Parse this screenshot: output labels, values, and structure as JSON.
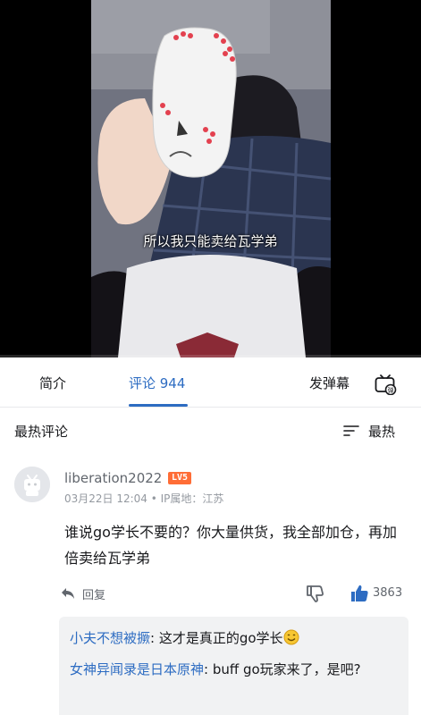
{
  "video": {
    "subtitle": "所以我只能卖给瓦学弟"
  },
  "tabs": {
    "intro": "简介",
    "comments": "评论 944",
    "danmaku": "发弹幕"
  },
  "sort": {
    "title": "最热评论",
    "toggle": "最热"
  },
  "comment": {
    "username": "liberation2022",
    "level": "LV5",
    "meta": "03月22日 12:04 • IP属地：江苏",
    "text": "谁说go学长不要的？你大量供货，我全部加仓，再加倍卖给瓦学弟",
    "reply_label": "回复",
    "like_count": "3863"
  },
  "replies": [
    {
      "user": "小夫不想被撅",
      "text": ": 这才是真正的go学长"
    },
    {
      "user": "女神异闻录是日本原神",
      "text": ": buff go玩家来了，是吧?"
    }
  ],
  "colors": {
    "accent": "#2d6cc2",
    "level_badge": "#ff6d36"
  }
}
